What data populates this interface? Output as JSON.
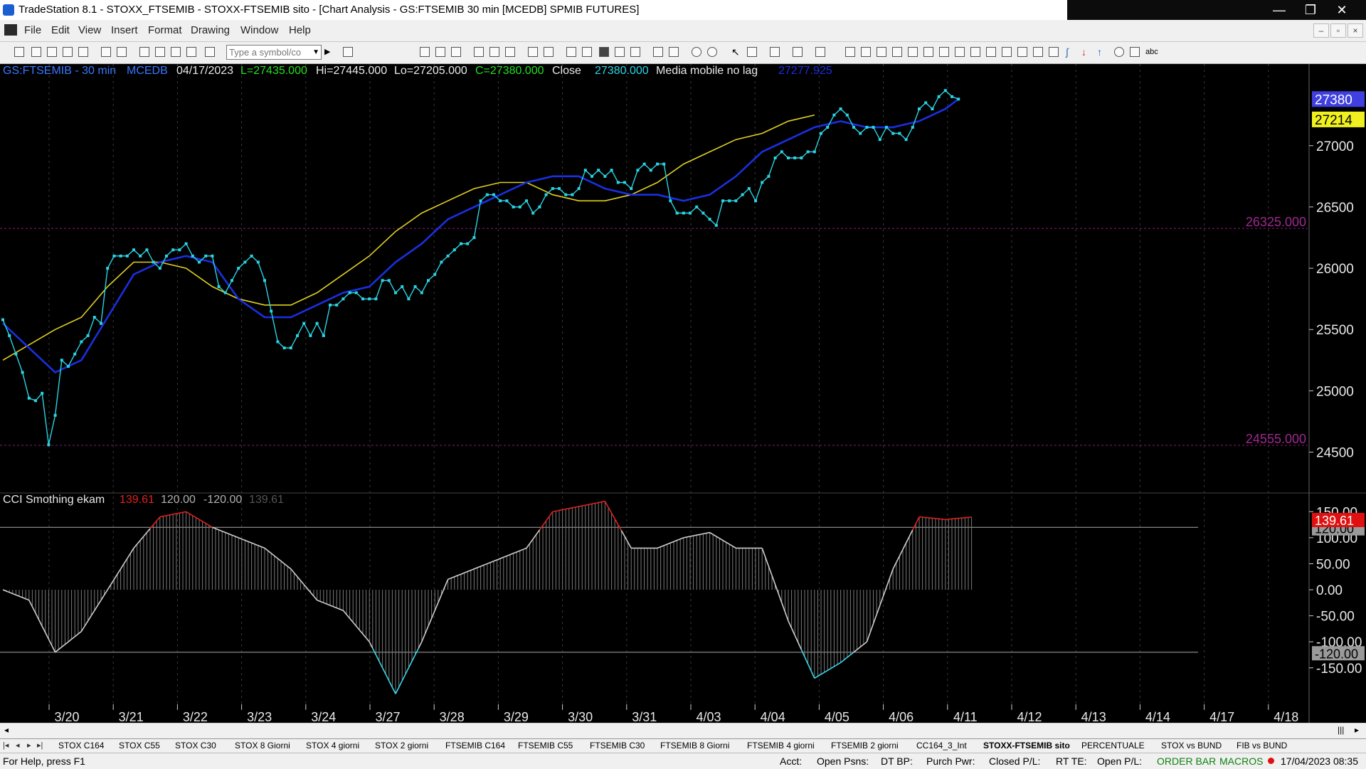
{
  "window": {
    "title": "TradeStation 8.1 - STOXX_FTSEMIB - STOXX-FTSEMIB sito - [Chart Analysis - GS:FTSEMIB  30 min  [MCEDB] SPMIB FUTURES]",
    "min": "—",
    "max": "❐",
    "close": "✕"
  },
  "menu": [
    "File",
    "Edit",
    "View",
    "Insert",
    "Format",
    "Drawing",
    "Window",
    "Help"
  ],
  "mdi_controls": [
    "–",
    "▫",
    "×"
  ],
  "toolbar": {
    "symbol_placeholder": "Type a symbol/co"
  },
  "chart_data": {
    "type": "line",
    "symbol_header": {
      "symbol": "GS:FTSEMIB - 30 min",
      "study": "MCEDB",
      "date": "04/17/2023",
      "low_label": "L=27435.000",
      "high_label": "Hi=27445.000",
      "lo_label": "Lo=27205.000",
      "close_label": "C=27380.000",
      "close_name": "Close",
      "close_value": "27380.000",
      "ma_name": "Media mobile no lag",
      "ma_value": "27277.925"
    },
    "x_labels": [
      "3/20",
      "3/21",
      "3/22",
      "3/23",
      "3/24",
      "3/27",
      "3/28",
      "3/29",
      "3/30",
      "3/31",
      "4/03",
      "4/04",
      "4/05",
      "4/06",
      "4/11",
      "4/12",
      "4/13",
      "4/14",
      "4/17",
      "4/18"
    ],
    "price_axis": {
      "ticks": [
        27000,
        26500,
        26000,
        25500,
        25000,
        24500
      ],
      "ylim": [
        24300,
        27550
      ],
      "last_price_tag": "27380",
      "ma_tag": "27214",
      "level_high": "26325.000",
      "level_low": "24555.000",
      "level_high_value": 26325,
      "level_low_value": 24555
    },
    "price_series": [
      [
        0,
        25580
      ],
      [
        1,
        25450
      ],
      [
        2,
        25300
      ],
      [
        3,
        25150
      ],
      [
        4,
        24940
      ],
      [
        5,
        24920
      ],
      [
        6,
        24980
      ],
      [
        7,
        24560
      ],
      [
        8,
        24800
      ],
      [
        9,
        25250
      ],
      [
        10,
        25200
      ],
      [
        11,
        25300
      ],
      [
        12,
        25400
      ],
      [
        13,
        25450
      ],
      [
        14,
        25600
      ],
      [
        15,
        25550
      ],
      [
        16,
        26000
      ],
      [
        17,
        26100
      ],
      [
        18,
        26100
      ],
      [
        19,
        26100
      ],
      [
        20,
        26150
      ],
      [
        21,
        26100
      ],
      [
        22,
        26150
      ],
      [
        23,
        26050
      ],
      [
        24,
        26000
      ],
      [
        25,
        26100
      ],
      [
        26,
        26150
      ],
      [
        27,
        26150
      ],
      [
        28,
        26200
      ],
      [
        29,
        26100
      ],
      [
        30,
        26050
      ],
      [
        31,
        26100
      ],
      [
        32,
        26100
      ],
      [
        33,
        25850
      ],
      [
        34,
        25800
      ],
      [
        35,
        25900
      ],
      [
        36,
        26000
      ],
      [
        37,
        26050
      ],
      [
        38,
        26100
      ],
      [
        39,
        26050
      ],
      [
        40,
        25900
      ],
      [
        41,
        25650
      ],
      [
        42,
        25400
      ],
      [
        43,
        25350
      ],
      [
        44,
        25350
      ],
      [
        45,
        25450
      ],
      [
        46,
        25550
      ],
      [
        47,
        25450
      ],
      [
        48,
        25550
      ],
      [
        49,
        25450
      ],
      [
        50,
        25700
      ],
      [
        51,
        25700
      ],
      [
        52,
        25750
      ],
      [
        53,
        25800
      ],
      [
        54,
        25800
      ],
      [
        55,
        25750
      ],
      [
        56,
        25750
      ],
      [
        57,
        25750
      ],
      [
        58,
        25900
      ],
      [
        59,
        25900
      ],
      [
        60,
        25800
      ],
      [
        61,
        25850
      ],
      [
        62,
        25750
      ],
      [
        63,
        25850
      ],
      [
        64,
        25800
      ],
      [
        65,
        25900
      ],
      [
        66,
        25950
      ],
      [
        67,
        26050
      ],
      [
        68,
        26100
      ],
      [
        69,
        26150
      ],
      [
        70,
        26200
      ],
      [
        71,
        26200
      ],
      [
        72,
        26250
      ],
      [
        73,
        26550
      ],
      [
        74,
        26600
      ],
      [
        75,
        26600
      ],
      [
        76,
        26550
      ],
      [
        77,
        26550
      ],
      [
        78,
        26500
      ],
      [
        79,
        26500
      ],
      [
        80,
        26550
      ],
      [
        81,
        26450
      ],
      [
        82,
        26500
      ],
      [
        83,
        26600
      ],
      [
        84,
        26650
      ],
      [
        85,
        26650
      ],
      [
        86,
        26600
      ],
      [
        87,
        26600
      ],
      [
        88,
        26650
      ],
      [
        89,
        26800
      ],
      [
        90,
        26750
      ],
      [
        91,
        26800
      ],
      [
        92,
        26750
      ],
      [
        93,
        26800
      ],
      [
        94,
        26700
      ],
      [
        95,
        26700
      ],
      [
        96,
        26650
      ],
      [
        97,
        26800
      ],
      [
        98,
        26850
      ],
      [
        99,
        26800
      ],
      [
        100,
        26850
      ],
      [
        101,
        26850
      ],
      [
        102,
        26550
      ],
      [
        103,
        26450
      ],
      [
        104,
        26450
      ],
      [
        105,
        26450
      ],
      [
        106,
        26500
      ],
      [
        107,
        26450
      ],
      [
        108,
        26400
      ],
      [
        109,
        26350
      ],
      [
        110,
        26550
      ],
      [
        111,
        26550
      ],
      [
        112,
        26550
      ],
      [
        113,
        26600
      ],
      [
        114,
        26650
      ],
      [
        115,
        26550
      ],
      [
        116,
        26700
      ],
      [
        117,
        26750
      ],
      [
        118,
        26900
      ],
      [
        119,
        26950
      ],
      [
        120,
        26900
      ],
      [
        121,
        26900
      ],
      [
        122,
        26900
      ],
      [
        123,
        26950
      ],
      [
        124,
        26950
      ],
      [
        125,
        27100
      ],
      [
        126,
        27150
      ],
      [
        127,
        27250
      ],
      [
        128,
        27300
      ],
      [
        129,
        27250
      ],
      [
        130,
        27150
      ],
      [
        131,
        27100
      ],
      [
        132,
        27150
      ],
      [
        133,
        27150
      ],
      [
        134,
        27050
      ],
      [
        135,
        27150
      ],
      [
        136,
        27100
      ],
      [
        137,
        27100
      ],
      [
        138,
        27050
      ],
      [
        139,
        27150
      ],
      [
        140,
        27300
      ],
      [
        141,
        27350
      ],
      [
        142,
        27300
      ],
      [
        143,
        27400
      ],
      [
        144,
        27450
      ],
      [
        145,
        27400
      ],
      [
        146,
        27380
      ]
    ],
    "ma_blue_series": [
      [
        0,
        25550
      ],
      [
        8,
        25150
      ],
      [
        12,
        25250
      ],
      [
        16,
        25600
      ],
      [
        20,
        25950
      ],
      [
        24,
        26050
      ],
      [
        28,
        26100
      ],
      [
        32,
        26050
      ],
      [
        36,
        25750
      ],
      [
        40,
        25600
      ],
      [
        44,
        25600
      ],
      [
        48,
        25700
      ],
      [
        52,
        25800
      ],
      [
        56,
        25850
      ],
      [
        60,
        26050
      ],
      [
        64,
        26200
      ],
      [
        68,
        26400
      ],
      [
        72,
        26500
      ],
      [
        76,
        26600
      ],
      [
        80,
        26700
      ],
      [
        84,
        26750
      ],
      [
        88,
        26750
      ],
      [
        92,
        26650
      ],
      [
        96,
        26600
      ],
      [
        100,
        26600
      ],
      [
        104,
        26550
      ],
      [
        108,
        26600
      ],
      [
        112,
        26750
      ],
      [
        116,
        26950
      ],
      [
        120,
        27050
      ],
      [
        124,
        27150
      ],
      [
        128,
        27200
      ],
      [
        132,
        27150
      ],
      [
        136,
        27150
      ],
      [
        140,
        27200
      ],
      [
        144,
        27300
      ],
      [
        146,
        27380
      ]
    ],
    "ma_yellow_series": [
      [
        0,
        25250
      ],
      [
        8,
        25500
      ],
      [
        12,
        25600
      ],
      [
        16,
        25850
      ],
      [
        20,
        26050
      ],
      [
        24,
        26050
      ],
      [
        28,
        26000
      ],
      [
        32,
        25850
      ],
      [
        36,
        25750
      ],
      [
        40,
        25700
      ],
      [
        44,
        25700
      ],
      [
        48,
        25800
      ],
      [
        52,
        25950
      ],
      [
        56,
        26100
      ],
      [
        60,
        26300
      ],
      [
        64,
        26450
      ],
      [
        68,
        26550
      ],
      [
        72,
        26650
      ],
      [
        76,
        26700
      ],
      [
        80,
        26700
      ],
      [
        84,
        26600
      ],
      [
        88,
        26550
      ],
      [
        92,
        26550
      ],
      [
        96,
        26600
      ],
      [
        100,
        26700
      ],
      [
        104,
        26850
      ],
      [
        108,
        26950
      ],
      [
        112,
        27050
      ],
      [
        116,
        27100
      ],
      [
        120,
        27200
      ],
      [
        124,
        27250
      ]
    ],
    "cci": {
      "title": "CCI Smothing ekam",
      "value": "139.61",
      "upper": "120.00",
      "lower": "-120.00",
      "value_faint": "139.61",
      "tag_value": "139.61",
      "tag_upper": "120.00",
      "tag_lower": "-120.00",
      "ticks": [
        "150.00",
        "100.00",
        "50.00",
        "0.00",
        "-50.00",
        "-100.00",
        "-150.00"
      ],
      "tick_values": [
        150,
        100,
        50,
        0,
        -50,
        -100,
        -150
      ],
      "ylim": [
        -220,
        190
      ],
      "upper_value": 120,
      "lower_value": -120,
      "series": [
        [
          0,
          0
        ],
        [
          4,
          -20
        ],
        [
          8,
          -120
        ],
        [
          12,
          -80
        ],
        [
          16,
          0
        ],
        [
          20,
          80
        ],
        [
          24,
          140
        ],
        [
          28,
          150
        ],
        [
          32,
          120
        ],
        [
          36,
          100
        ],
        [
          40,
          80
        ],
        [
          44,
          40
        ],
        [
          48,
          -20
        ],
        [
          52,
          -40
        ],
        [
          56,
          -100
        ],
        [
          60,
          -200
        ],
        [
          64,
          -100
        ],
        [
          68,
          20
        ],
        [
          72,
          40
        ],
        [
          76,
          60
        ],
        [
          80,
          80
        ],
        [
          84,
          150
        ],
        [
          88,
          160
        ],
        [
          92,
          170
        ],
        [
          96,
          80
        ],
        [
          100,
          80
        ],
        [
          104,
          100
        ],
        [
          108,
          110
        ],
        [
          112,
          80
        ],
        [
          116,
          80
        ],
        [
          120,
          -60
        ],
        [
          124,
          -170
        ],
        [
          128,
          -140
        ],
        [
          132,
          -100
        ],
        [
          136,
          40
        ],
        [
          140,
          140
        ],
        [
          144,
          135
        ],
        [
          148,
          139.61
        ]
      ]
    }
  },
  "sheet_tabs": [
    "STOX C164",
    "STOX C55",
    "STOX  C30",
    "STOX  8 Giorni",
    "STOX 4 giorni",
    "STOX  2 giorni",
    "FTSEMIB C164",
    "FTSEMIB C55",
    "FTSEMIB C30",
    "FTSEMIB  8 Giorni",
    "FTSEMIB  4 giorni",
    "FTSEMIB  2 giorni",
    "CC164_3_Int",
    "STOXX-FTSEMIB sito",
    "PERCENTUALE",
    "STOX vs BUND",
    "FIB vs BUND"
  ],
  "status": {
    "help": "For Help, press F1",
    "acct": "Acct:",
    "open_psns": "Open Psns:",
    "dt_bp": "DT BP:",
    "purch_pwr": "Purch Pwr:",
    "closed_pl": "Closed P/L:",
    "rt_te": "RT TE:",
    "open_pl": "Open P/L:",
    "order_bar": "ORDER BAR",
    "macros": "MACROS",
    "datetime": "17/04/2023 08:35"
  },
  "colors": {
    "price": "#2ad4e4",
    "ma_blue": "#1a2fe0",
    "ma_yellow": "#e0d020",
    "cci_up": "#e02020",
    "cci_down": "#3ad8e8",
    "level": "#8a1a7a"
  }
}
